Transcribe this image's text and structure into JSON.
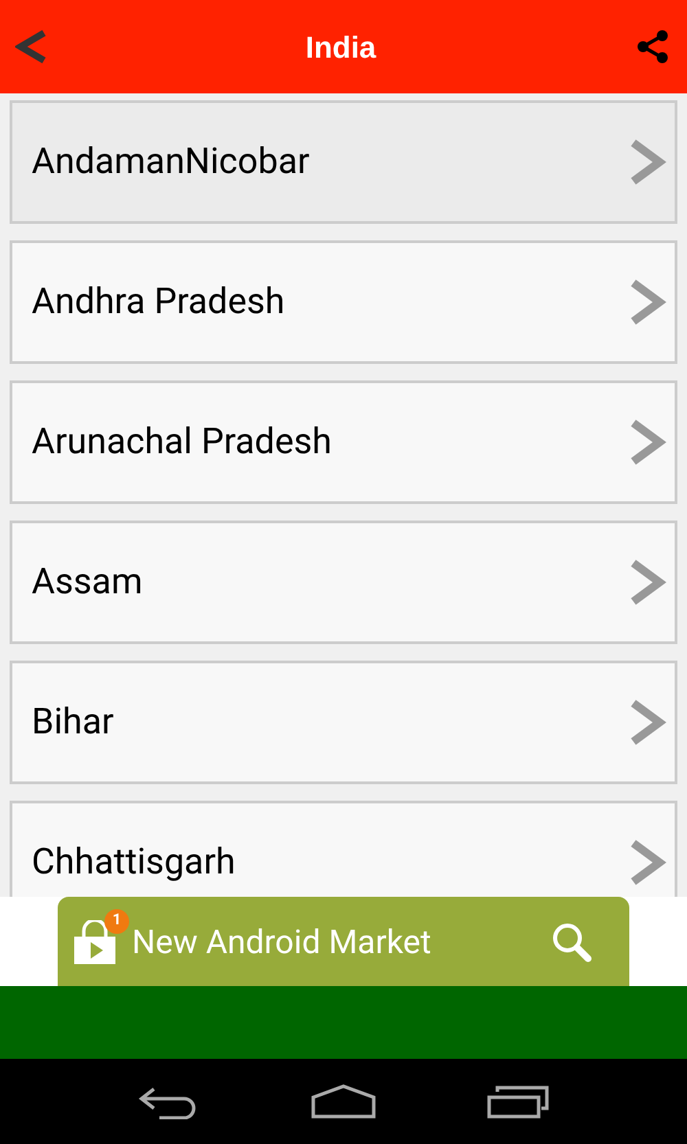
{
  "header": {
    "title": "India"
  },
  "states": [
    {
      "name": "AndamanNicobar",
      "selected": true
    },
    {
      "name": "Andhra Pradesh",
      "selected": false
    },
    {
      "name": "Arunachal Pradesh",
      "selected": false
    },
    {
      "name": "Assam",
      "selected": false
    },
    {
      "name": "Bihar",
      "selected": false
    },
    {
      "name": "Chhattisgarh",
      "selected": false
    }
  ],
  "ad_banner": {
    "text": "New Android Market",
    "badge": "1"
  }
}
